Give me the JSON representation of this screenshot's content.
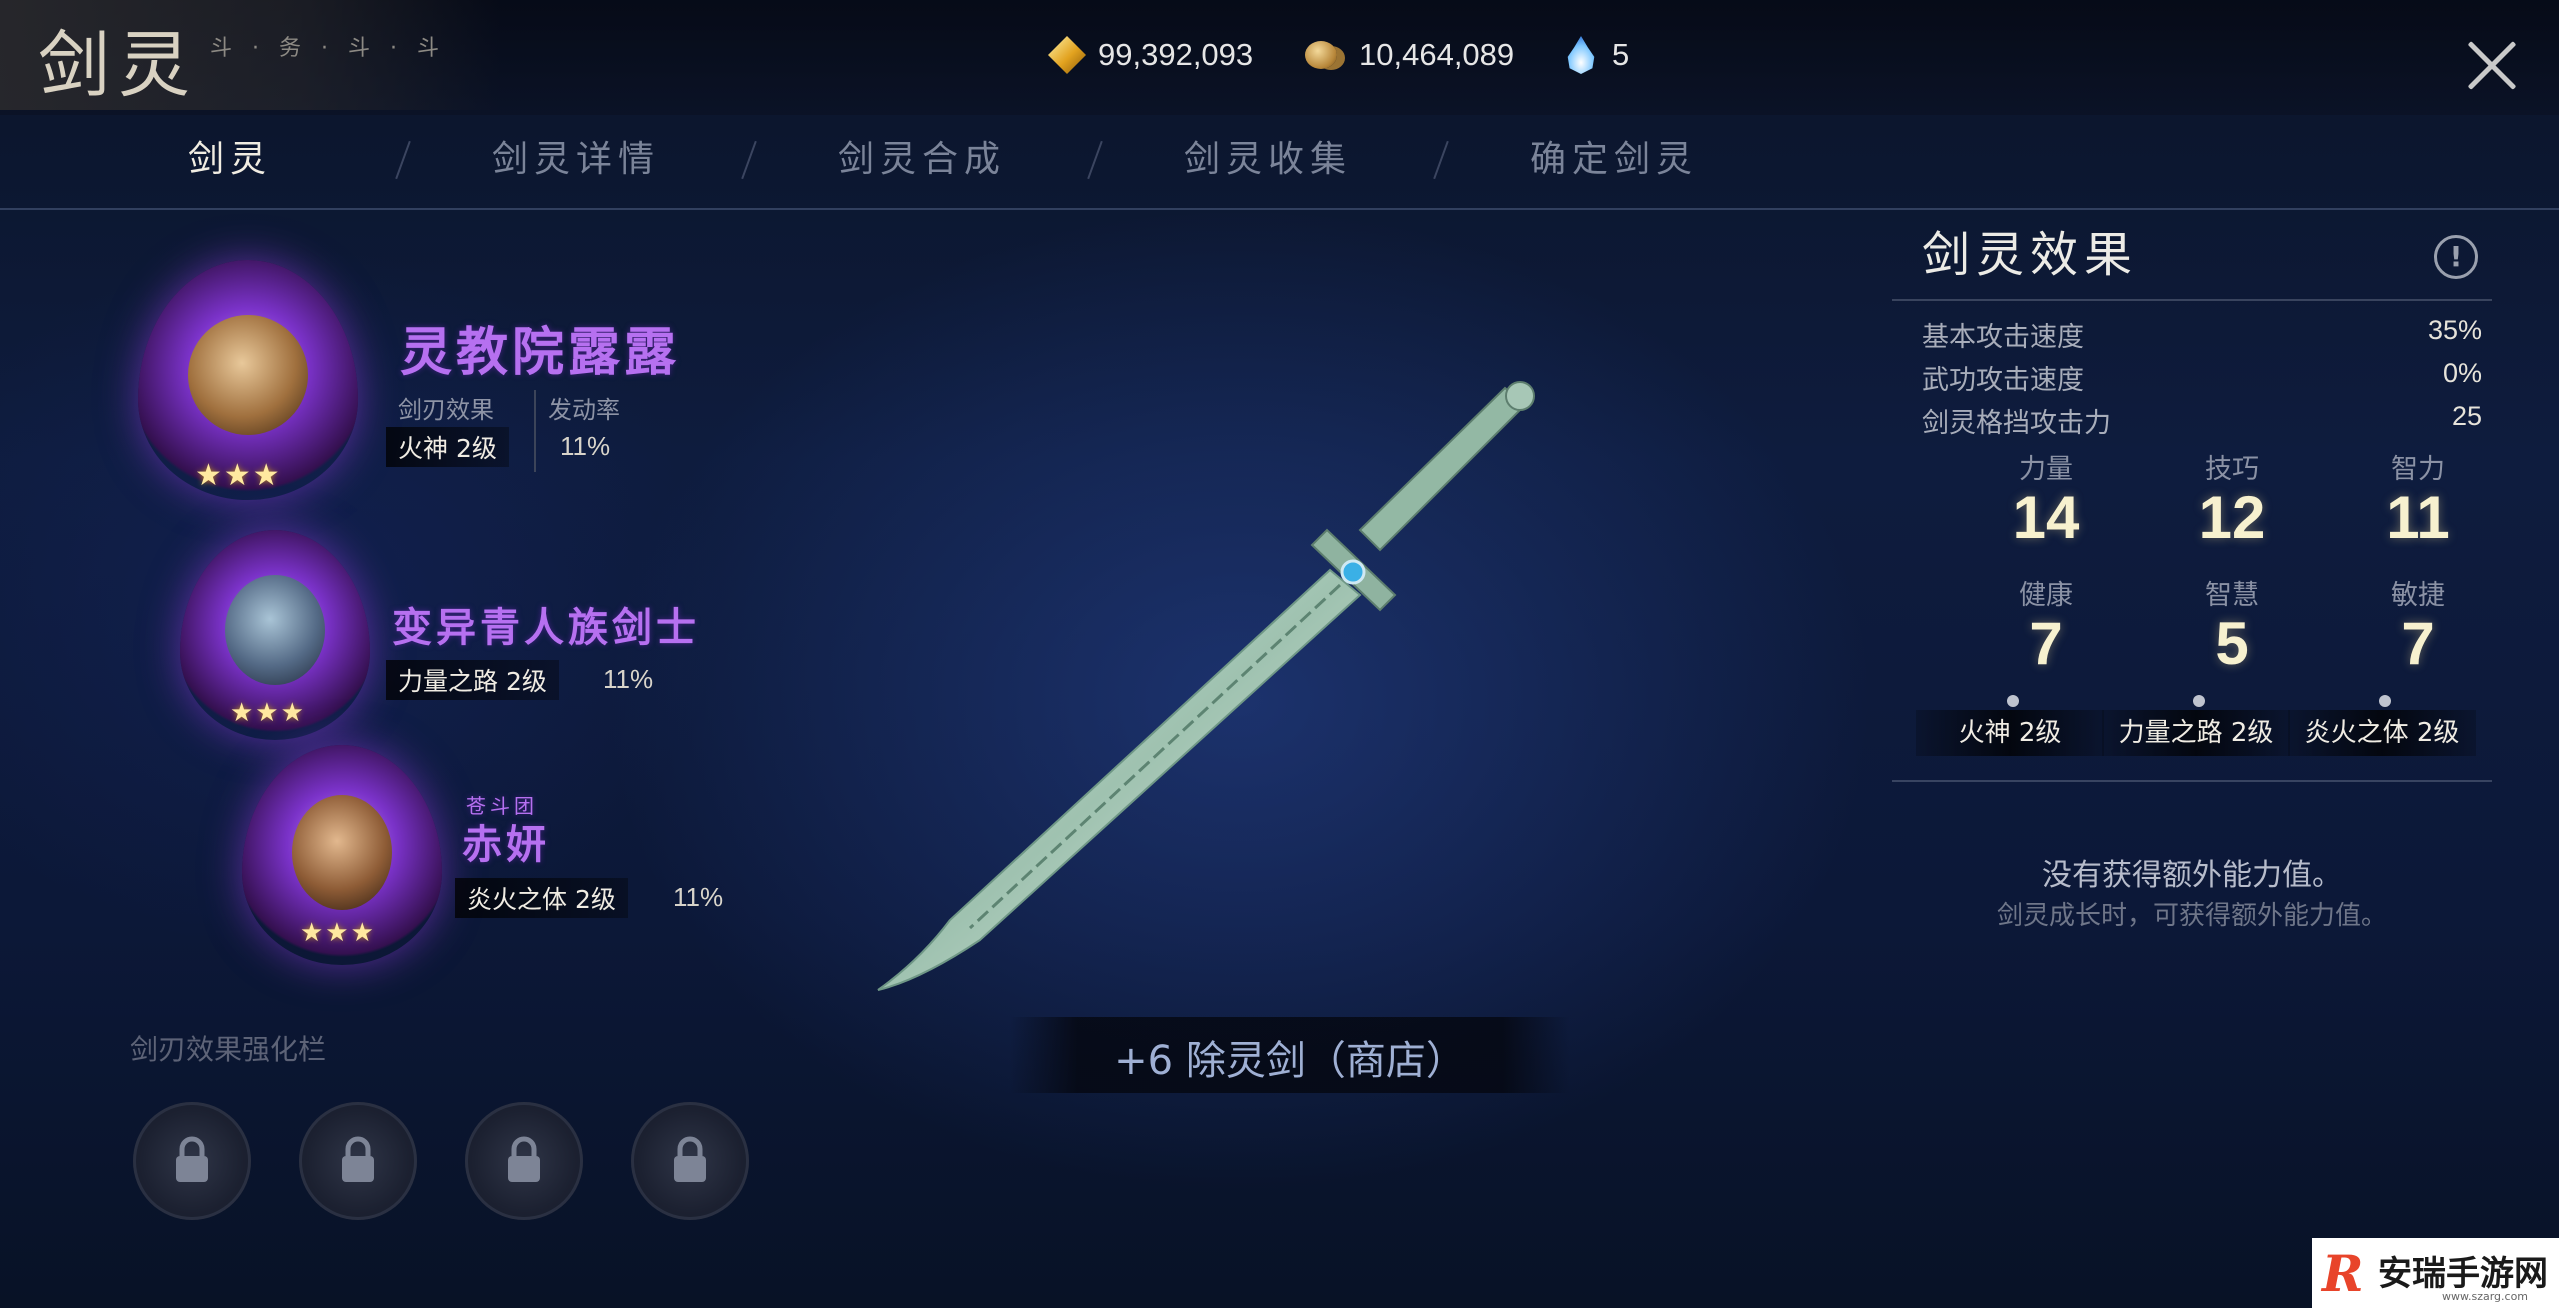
{
  "header": {
    "title": "剑灵",
    "subtitle": "斗·务·斗·斗",
    "currencies": [
      {
        "icon": "gold-gem-icon",
        "value": "99,392,093"
      },
      {
        "icon": "coin-stack-icon",
        "value": "10,464,089"
      },
      {
        "icon": "blue-flame-icon",
        "value": "5"
      }
    ]
  },
  "tabs": [
    {
      "label": "剑灵",
      "active": true
    },
    {
      "label": "剑灵详情",
      "active": false
    },
    {
      "label": "剑灵合成",
      "active": false
    },
    {
      "label": "剑灵收集",
      "active": false
    },
    {
      "label": "确定剑灵",
      "active": false
    }
  ],
  "spirits": [
    {
      "name": "灵教院露露",
      "effect_header": "剑刃效果",
      "rate_header": "发动率",
      "effect": "火神 2级",
      "rate": "11%",
      "stars": "★★★"
    },
    {
      "name": "变异青人族剑士",
      "effect": "力量之路 2级",
      "rate": "11%",
      "stars": "★★★"
    },
    {
      "org": "苍斗团",
      "name": "赤妍",
      "effect": "炎火之体 2级",
      "rate": "11%",
      "stars": "★★★"
    }
  ],
  "enhance": {
    "label": "剑刃效果强化栏",
    "slots": 4
  },
  "sword": {
    "name": "+6 除灵剑（商店）",
    "blade_color": "#b8d4c4"
  },
  "panel": {
    "title": "剑灵效果",
    "stats": [
      {
        "label": "基本攻击速度",
        "value": "35%"
      },
      {
        "label": "武功攻击速度",
        "value": "0%"
      },
      {
        "label": "剑灵格挡攻击力",
        "value": "25"
      }
    ],
    "attributes": [
      {
        "label": "力量",
        "value": "14"
      },
      {
        "label": "技巧",
        "value": "12"
      },
      {
        "label": "智力",
        "value": "11"
      },
      {
        "label": "健康",
        "value": "7"
      },
      {
        "label": "智慧",
        "value": "5"
      },
      {
        "label": "敏捷",
        "value": "7"
      }
    ],
    "effects": [
      "火神 2级",
      "力量之路 2级",
      "炎火之体 2级"
    ],
    "no_extra": "没有获得额外能力值。",
    "no_extra_sub": "剑灵成长时，可获得额外能力值。"
  },
  "watermark": {
    "brand": "安瑞手游网",
    "mark": "R",
    "url": "www.szarg.com"
  },
  "colors": {
    "accent_purple": "#b670f0",
    "bg": "#0e1c3e",
    "attr_number": "#f7f1cf"
  }
}
